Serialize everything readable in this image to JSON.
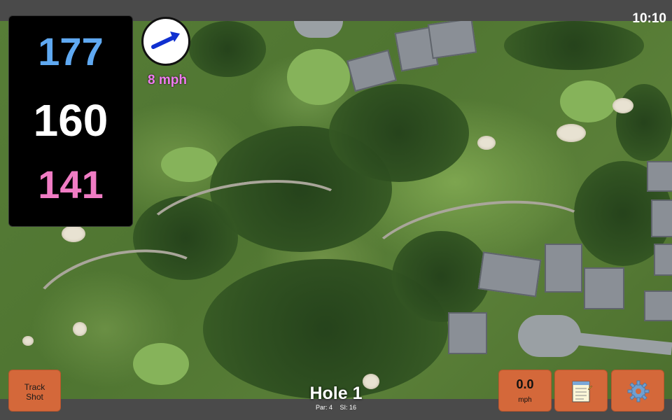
{
  "status_bar": {
    "time": "10:10"
  },
  "distances": {
    "back": "177",
    "middle": "160",
    "front": "141"
  },
  "wind": {
    "speed": "8 mph",
    "direction_icon": "wind-arrow-icon"
  },
  "hole": {
    "title": "Hole 1",
    "par": "Par: 4",
    "stroke_index": "SI: 16"
  },
  "buttons": {
    "track_shot_line1": "Track",
    "track_shot_line2": "Shot",
    "speed_value": "0.0",
    "speed_unit": "mph",
    "notes_icon": "notepad-icon",
    "settings_icon": "gear-icon"
  },
  "colors": {
    "back": "#5fa9f2",
    "middle": "#ffffff",
    "front": "#f07cc4",
    "wind_text": "#f07cf0",
    "button": "#d4683a"
  }
}
